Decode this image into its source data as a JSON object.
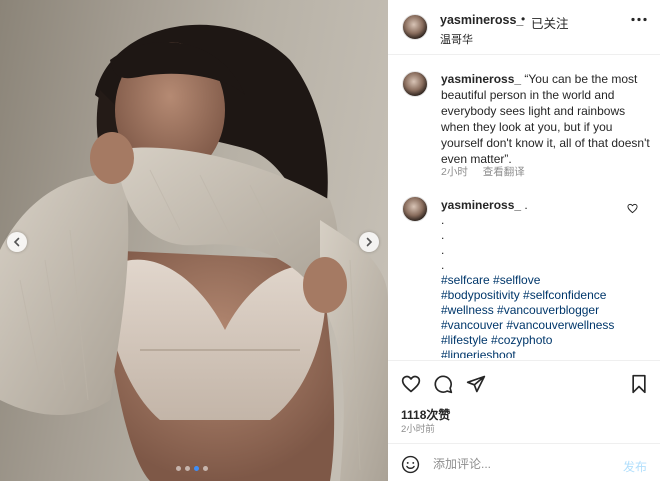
{
  "post": {
    "username": "yasmineross_",
    "separator": "•",
    "follow_label": "已关注",
    "location": "温哥华"
  },
  "caption": {
    "username": "yasmineross_",
    "quote": "“You can be the most beautiful person in the world and everybody sees light and rainbows when they look at you, but if you yourself don't know it, all of that doesn't even matter”.",
    "time": "2小时",
    "translate_label": "查看翻译"
  },
  "comment": {
    "username": "yasmineross_",
    "first_text": ".",
    "dot_lines": [
      ".",
      ".",
      ".",
      "."
    ],
    "hashtags": [
      "#selfcare #selflove",
      "#bodypositivity #selfconfidence",
      "#wellness #vancouverblogger",
      "#vancouver #vancouverwellness",
      "#lifestyle #cozyphoto",
      "#lingerieshoot"
    ]
  },
  "stats": {
    "likes": "1118次赞",
    "time": "2小时前"
  },
  "comment_box": {
    "placeholder": "添加评论...",
    "post_label": "发布"
  },
  "carousel": {
    "slide_count": 4,
    "active_index": 2
  },
  "colors": {
    "hashtag": "#00376b",
    "active_dot": "#3e8ef7",
    "post_button_disabled": "#b2dffc",
    "muted_text": "#8e8e8e"
  },
  "icons": [
    "chevron-left-icon",
    "chevron-right-icon",
    "more-horizontal-icon",
    "heart-icon",
    "comment-icon",
    "share-icon",
    "bookmark-icon",
    "emoji-icon"
  ]
}
